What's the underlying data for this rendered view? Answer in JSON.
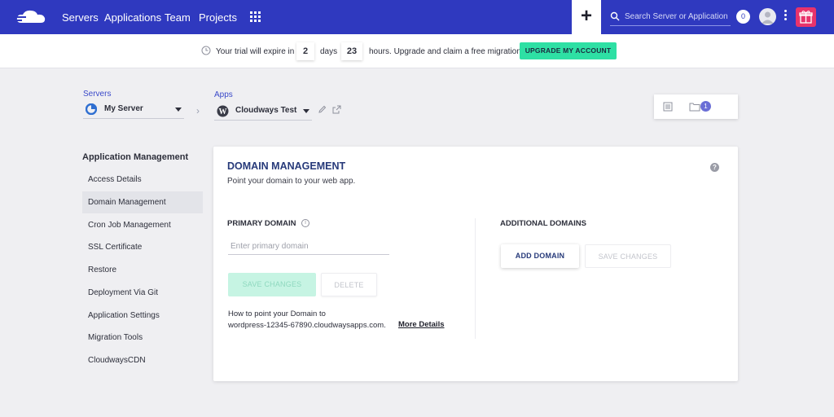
{
  "header": {
    "nav": [
      "Servers",
      "Applications",
      "Team",
      "Projects"
    ],
    "search_placeholder": "Search Server or Application",
    "notification_count": "0"
  },
  "banner": {
    "text_before": "Your trial will expire in",
    "days": "2",
    "days_label": "days",
    "hours": "23",
    "text_after": "hours. Upgrade and claim a free migration",
    "upgrade_button": "UPGRADE MY ACCOUNT"
  },
  "breadcrumb": {
    "servers_label": "Servers",
    "server_name": "My Server",
    "apps_label": "Apps",
    "app_name": "Cloudways Test",
    "folder_count": "1"
  },
  "sidebar": {
    "title": "Application Management",
    "items": [
      {
        "label": "Access Details"
      },
      {
        "label": "Domain Management"
      },
      {
        "label": "Cron Job Management"
      },
      {
        "label": "SSL Certificate"
      },
      {
        "label": "Restore"
      },
      {
        "label": "Deployment Via Git"
      },
      {
        "label": "Application Settings"
      },
      {
        "label": "Migration Tools"
      },
      {
        "label": "CloudwaysCDN"
      }
    ],
    "active_index": 1
  },
  "main": {
    "title": "DOMAIN MANAGEMENT",
    "subtitle": "Point your domain to your web app.",
    "primary_label": "PRIMARY DOMAIN",
    "primary_placeholder": "Enter primary domain",
    "save_label": "SAVE CHANGES",
    "delete_label": "DELETE",
    "howto_line1": "How to point your Domain to",
    "howto_line2": "wordpress-12345-67890.cloudwaysapps.com.",
    "more_details": "More Details",
    "additional_label": "ADDITIONAL DOMAINS",
    "add_domain_label": "ADD DOMAIN",
    "save2_label": "SAVE CHANGES"
  },
  "colors": {
    "topbar": "#2f39bf",
    "upgrade": "#2ee0a4",
    "gift": "#e8336b"
  }
}
